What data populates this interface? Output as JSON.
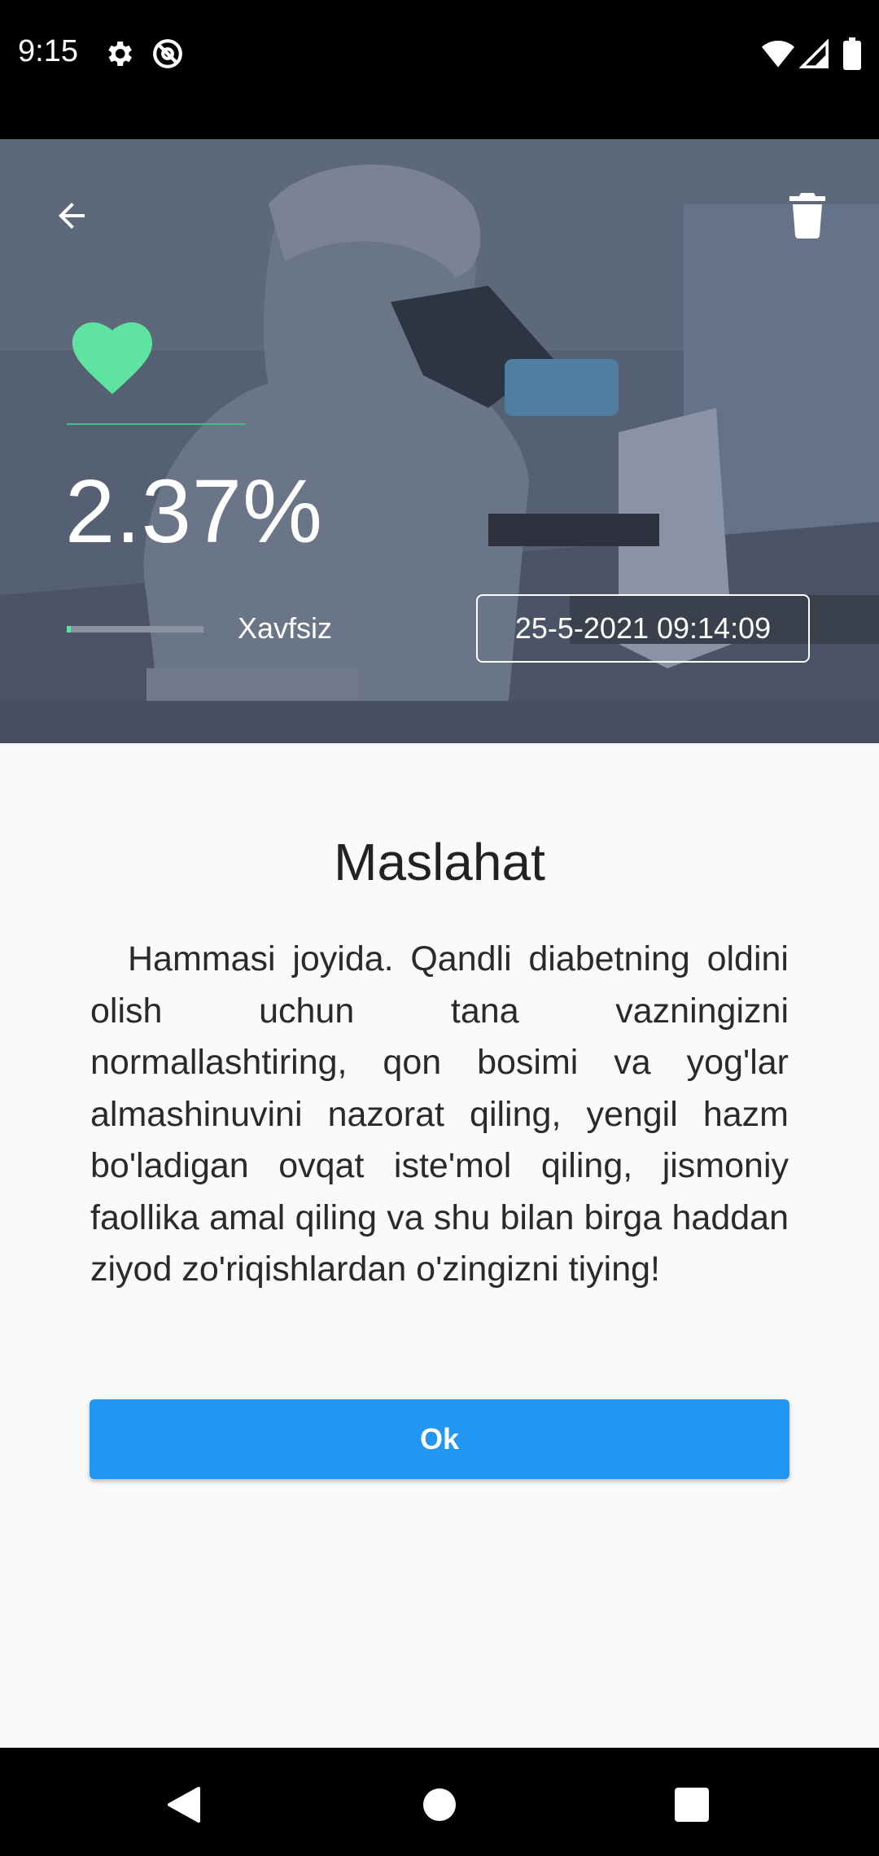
{
  "status_bar": {
    "time": "9:15",
    "icons_left": [
      "settings-icon",
      "at-icon"
    ],
    "icons_right": [
      "wifi-icon",
      "signal-icon",
      "battery-icon"
    ]
  },
  "header": {
    "back_icon": "arrow-left-icon",
    "delete_icon": "trash-icon",
    "status_icon": "heart-icon",
    "status_color": "#5fe3a1",
    "percent": "2.37%",
    "risk_level_fraction": 0.03,
    "risk_label": "Xavfsiz",
    "date": "25-5-2021 09:14:09"
  },
  "advice": {
    "title": "Maslahat",
    "text": "Hammasi joyida. Qandli diabetning oldini olish uchun tana vazningizni normallashtiring, qon bosimi va yog'lar almashinuvini nazorat qiling, yengil hazm bo'ladigan ovqat iste'mol qiling, jismoniy faollika amal qiling va shu bilan birga haddan ziyod zo'riqishlardan o'zingizni tiying!",
    "ok_label": "Ok",
    "button_color": "#2196f3"
  },
  "nav_bar": {
    "icons": [
      "back-triangle-icon",
      "home-circle-icon",
      "recents-square-icon"
    ]
  }
}
